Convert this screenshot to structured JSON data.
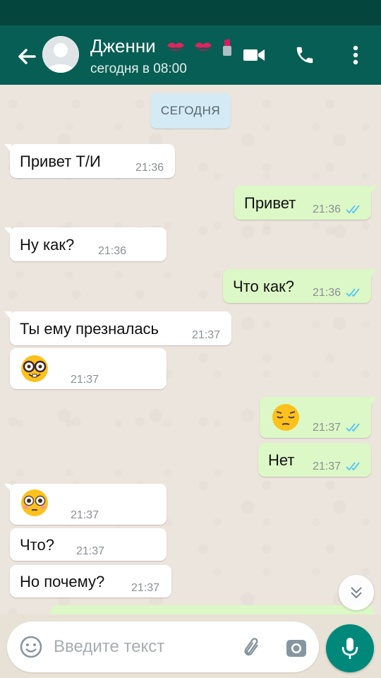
{
  "header": {
    "contact_name": "Дженни",
    "contact_status": "сегодня в 08:00",
    "name_decoration_icons": [
      "kiss-mark-icon",
      "kiss-mark-icon",
      "lipstick-icon"
    ]
  },
  "chat": {
    "date_chip": "СЕГОДНЯ",
    "messages": [
      {
        "dir": "in",
        "text": "Привет Т/И",
        "time": "21:36"
      },
      {
        "dir": "out",
        "text": "Привет",
        "time": "21:36",
        "status": "read"
      },
      {
        "dir": "in",
        "text": "Ну как?",
        "time": "21:36"
      },
      {
        "dir": "out",
        "text": "Что как?",
        "time": "21:36",
        "status": "read"
      },
      {
        "dir": "in",
        "text": "Ты ему презналась",
        "time": "21:37"
      },
      {
        "dir": "in",
        "emoji": "nerd-face-emoji",
        "time": "21:37"
      },
      {
        "dir": "out",
        "emoji": "pensive-face-emoji",
        "time": "21:37",
        "status": "read"
      },
      {
        "dir": "out",
        "text": "Нет",
        "time": "21:37",
        "status": "read"
      },
      {
        "dir": "in",
        "emoji": "flushed-face-emoji",
        "time": "21:37"
      },
      {
        "dir": "in",
        "text": "Что?",
        "time": "21:37"
      },
      {
        "dir": "in",
        "text": "Но почему?",
        "time": "21:37"
      }
    ]
  },
  "input": {
    "placeholder": "Введите текст"
  },
  "colors": {
    "header": "#075e54",
    "status_bar": "#04453d",
    "incoming_bubble": "#ffffff",
    "outgoing_bubble": "#dcf8c6",
    "read_ticks": "#4fc3f7",
    "mic_button": "#00897b"
  }
}
